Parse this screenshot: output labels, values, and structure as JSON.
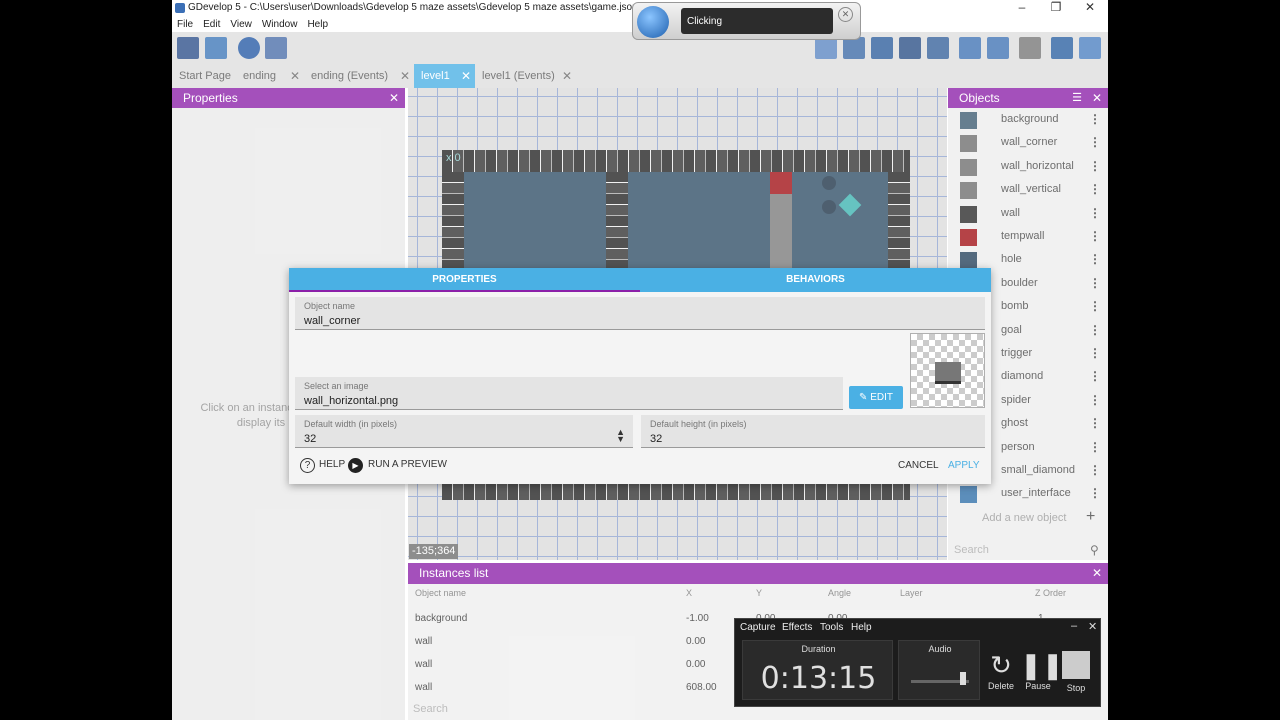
{
  "window": {
    "title": "GDevelop 5 - C:\\Users\\user\\Downloads\\Gdevelop 5 maze assets\\Gdevelop 5 maze assets\\game.json *",
    "minimize": "–",
    "maximize": "❐",
    "close": "✕"
  },
  "menu": [
    "File",
    "Edit",
    "View",
    "Window",
    "Help"
  ],
  "tabs": [
    {
      "label": "Start Page",
      "close": ""
    },
    {
      "label": "ending",
      "close": "✕"
    },
    {
      "label": "ending (Events)",
      "close": "✕"
    },
    {
      "label": "level1",
      "close": "✕"
    },
    {
      "label": "level1 (Events)",
      "close": "✕"
    }
  ],
  "properties_panel": {
    "title": "Properties",
    "close": "✕",
    "hint": "Click on an instance in the scene to display its properties"
  },
  "scene": {
    "coords": "-135;364",
    "counter": "x 0"
  },
  "objects_panel": {
    "title": "Objects",
    "close": "✕",
    "items": [
      {
        "name": "background",
        "color": "#3b5a70"
      },
      {
        "name": "wall_corner",
        "color": "#6d6d6d"
      },
      {
        "name": "wall_horizontal",
        "color": "#6d6d6d"
      },
      {
        "name": "wall_vertical",
        "color": "#6d6d6d"
      },
      {
        "name": "wall",
        "color": "#2a2a2a"
      },
      {
        "name": "tempwall",
        "color": "#a10f14"
      },
      {
        "name": "hole",
        "color": "#24405a"
      },
      {
        "name": "boulder",
        "color": "#8a8a8a"
      },
      {
        "name": "bomb",
        "color": "#333333"
      },
      {
        "name": "goal",
        "color": "#c9a347"
      },
      {
        "name": "trigger",
        "color": "#b9b9b9"
      },
      {
        "name": "diamond",
        "color": "#3bb3b0"
      },
      {
        "name": "spider",
        "color": "#444444"
      },
      {
        "name": "ghost",
        "color": "#d9d9d9"
      },
      {
        "name": "person",
        "color": "#c98a5c"
      },
      {
        "name": "small_diamond",
        "color": "#3bb3b0"
      },
      {
        "name": "user_interface",
        "color": "#2f6fa8"
      }
    ],
    "add_label": "Add a new object",
    "add_plus": "+",
    "search_placeholder": "Search"
  },
  "instances_panel": {
    "title": "Instances list",
    "close": "✕",
    "columns": [
      "Object name",
      "X",
      "Y",
      "Angle",
      "Layer",
      "Z Order"
    ],
    "rows": [
      {
        "name": "background",
        "x": "-1.00",
        "y": "0.00",
        "angle": "0.00",
        "layer": "",
        "z": "1"
      },
      {
        "name": "wall",
        "x": "0.00",
        "y": "",
        "angle": "",
        "layer": "",
        "z": ""
      },
      {
        "name": "wall",
        "x": "0.00",
        "y": "",
        "angle": "",
        "layer": "",
        "z": ""
      },
      {
        "name": "wall",
        "x": "608.00",
        "y": "",
        "angle": "",
        "layer": "",
        "z": ""
      }
    ],
    "search_placeholder": "Search"
  },
  "dialog": {
    "tab_properties": "PROPERTIES",
    "tab_behaviors": "BEHAVIORS",
    "object_name_label": "Object name",
    "object_name_value": "wall_corner",
    "image_label": "Select an image",
    "image_value": "wall_horizontal.png",
    "edit_label": "EDIT",
    "width_label": "Default width (in pixels)",
    "width_value": "32",
    "height_label": "Default height (in pixels)",
    "height_value": "32",
    "help_label": "HELP",
    "preview_label": "RUN A PREVIEW",
    "cancel_label": "CANCEL",
    "apply_label": "APPLY"
  },
  "voice_overlay": {
    "text": "Clicking",
    "close": "✕"
  },
  "recorder": {
    "menu": [
      "Capture",
      "Effects",
      "Tools",
      "Help"
    ],
    "minimize": "–",
    "close": "✕",
    "duration_label": "Duration",
    "duration_value": "0:13:15",
    "audio_label": "Audio",
    "audio_level": 0.9,
    "delete_label": "Delete",
    "pause_label": "Pause",
    "stop_label": "Stop"
  },
  "colors": {
    "accent_purple": "#8b1fa8",
    "accent_blue": "#4ab0e4"
  }
}
